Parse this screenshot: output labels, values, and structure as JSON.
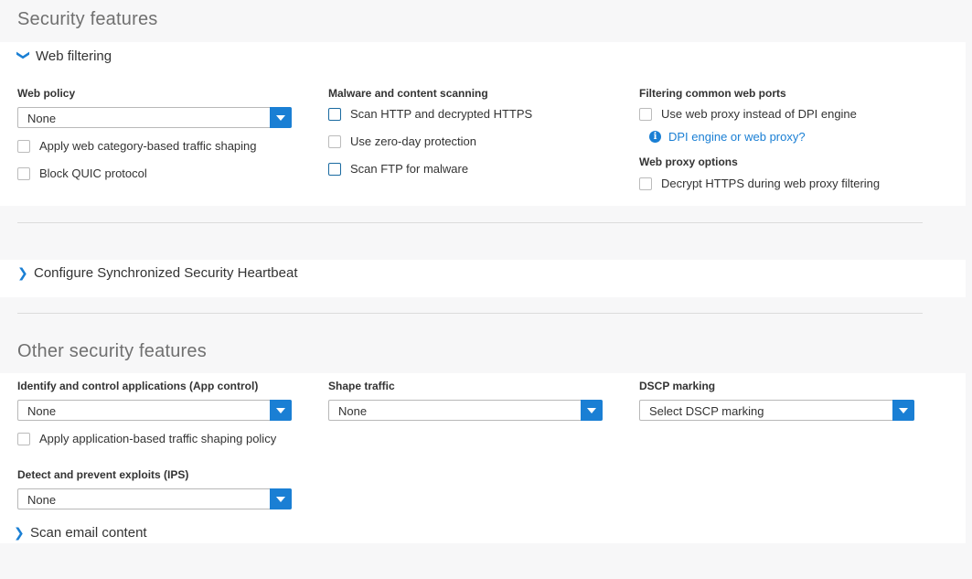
{
  "page": {
    "security_title": "Security features",
    "other_title": "Other security features"
  },
  "web_filtering": {
    "toggle_label": "Web filtering",
    "web_policy": {
      "label": "Web policy",
      "value": "None",
      "apply_shaping": "Apply web category-based traffic shaping",
      "block_quic": "Block QUIC protocol"
    },
    "malware": {
      "label": "Malware and content scanning",
      "scan_http": "Scan HTTP and decrypted HTTPS",
      "zero_day": "Use zero-day protection",
      "scan_ftp": "Scan FTP for malware"
    },
    "ports": {
      "label": "Filtering common web ports",
      "use_proxy": "Use web proxy instead of DPI engine",
      "info_link": "DPI engine or web proxy?",
      "proxy_options_label": "Web proxy options",
      "decrypt_https": "Decrypt HTTPS during web proxy filtering"
    }
  },
  "heartbeat": {
    "toggle_label": "Configure Synchronized Security Heartbeat"
  },
  "other": {
    "app_control": {
      "label": "Identify and control applications (App control)",
      "value": "None",
      "apply_shaping": "Apply application-based traffic shaping policy"
    },
    "shape_traffic": {
      "label": "Shape traffic",
      "value": "None"
    },
    "dscp": {
      "label": "DSCP marking",
      "value": "Select DSCP marking"
    },
    "ips": {
      "label": "Detect and prevent exploits (IPS)",
      "value": "None"
    },
    "scan_email": {
      "toggle_label": "Scan email content"
    }
  },
  "colors": {
    "accent": "#1a7fd4",
    "background": "#f7f7f8",
    "panel": "#ffffff"
  }
}
